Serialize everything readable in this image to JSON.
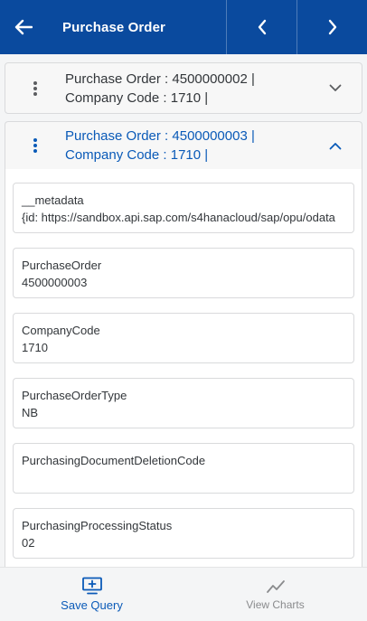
{
  "header": {
    "title": "Purchase Order",
    "back_icon": "arrow-left-icon",
    "prev_icon": "chevron-left-icon",
    "next_icon": "chevron-right-icon"
  },
  "records": [
    {
      "line1": "Purchase Order : 4500000002 |",
      "line2": "Company Code : 1710 |",
      "expanded": false
    },
    {
      "line1": "Purchase Order : 4500000003 |",
      "line2": "Company Code : 1710 |",
      "expanded": true,
      "fields": [
        {
          "label": "__metadata",
          "value": "{id: https://sandbox.api.sap.com/s4hanacloud/sap/opu/odata"
        },
        {
          "label": "PurchaseOrder",
          "value": "4500000003"
        },
        {
          "label": "CompanyCode",
          "value": "1710"
        },
        {
          "label": "PurchaseOrderType",
          "value": "NB"
        },
        {
          "label": "PurchasingDocumentDeletionCode",
          "value": ""
        },
        {
          "label": "PurchasingProcessingStatus",
          "value": "02"
        }
      ]
    }
  ],
  "footer": {
    "save_label": "Save Query",
    "charts_label": "View Charts"
  },
  "colors": {
    "header_bg": "#0a4a9e",
    "accent": "#0a5ab8",
    "muted": "#8a8b8d"
  }
}
